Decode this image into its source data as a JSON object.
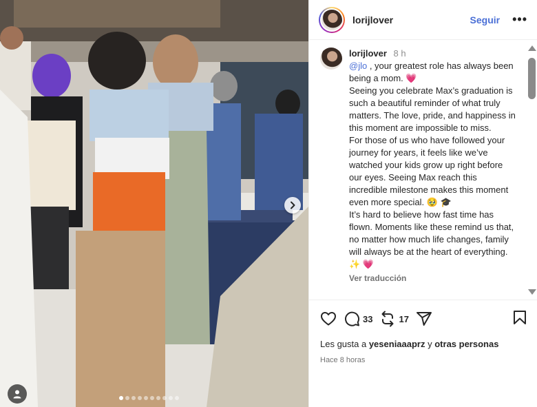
{
  "post": {
    "username": "lorijlover",
    "follow_label": "Seguir",
    "more_label": "•••"
  },
  "caption": {
    "username": "lorijlover",
    "time": "8 h",
    "mention": "@jlo",
    "p1_rest": " , your greatest role has always been being a mom. ",
    "p1_emoji": "💗",
    "p2": "Seeing you celebrate Max’s graduation is such a beautiful reminder of what truly matters. The love, pride, and happiness in this moment are impossible to miss.",
    "p3": "For those of us who have followed your journey for years, it feels like we’ve watched your kids grow up right before our eyes. Seeing Max reach this incredible milestone makes this moment even more special. ",
    "p3_emoji": "🥹 🎓",
    "p4": "It’s hard to believe how fast time has flown. Moments like these remind us that, no matter how much life changes, family will always be at the heart of everything. ",
    "p4_emoji": "✨ 💗",
    "translate_label": "Ver traducción"
  },
  "actions": {
    "comment_count": "33",
    "repost_count": "17"
  },
  "likes": {
    "prefix": "Les gusta a ",
    "user": "yeseniaaaprz",
    "middle": " y ",
    "others": "otras personas"
  },
  "time_ago": "Hace 8 horas",
  "icons": [
    "heart-icon",
    "comment-icon",
    "repost-icon",
    "share-icon",
    "bookmark-icon",
    "chevron-right-icon",
    "user-icon"
  ],
  "colors": {
    "link": "#4a6fd6",
    "heart": "#e0245e"
  },
  "carousel": {
    "slide_count": 10,
    "active_index": 0
  }
}
